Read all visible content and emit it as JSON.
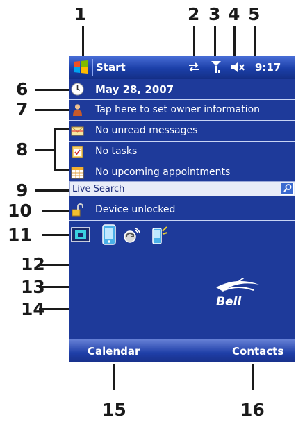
{
  "callouts": [
    "1",
    "2",
    "3",
    "4",
    "5",
    "6",
    "7",
    "8",
    "9",
    "10",
    "11",
    "12",
    "13",
    "14",
    "15",
    "16"
  ],
  "titlebar": {
    "start_label": "Start",
    "time": "9:17"
  },
  "today": {
    "date": "May 28, 2007",
    "owner": "Tap here to set owner information",
    "messages": "No unread messages",
    "tasks": "No tasks",
    "appointments": "No upcoming appointments",
    "search_label": "Live Search",
    "device_lock": "Device unlocked"
  },
  "logo": {
    "text": "Bell"
  },
  "softkeys": {
    "left": "Calendar",
    "right": "Contacts"
  },
  "colors": {
    "screen_bg": "#1e3a9a",
    "titlebar": "#1b3fa8",
    "text": "#ffffff"
  }
}
